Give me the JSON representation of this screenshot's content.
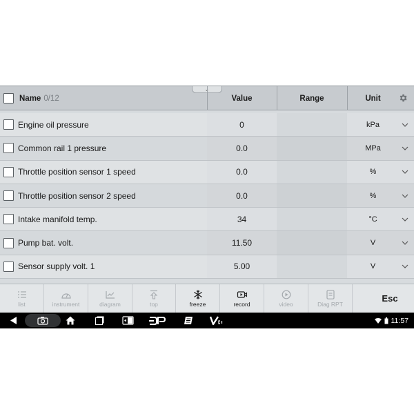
{
  "header": {
    "name_label": "Name",
    "count": "0/12",
    "value_label": "Value",
    "range_label": "Range",
    "unit_label": "Unit"
  },
  "rows": [
    {
      "name": "Engine oil pressure",
      "value": "0",
      "range": "",
      "unit": "kPa"
    },
    {
      "name": "Common rail 1 pressure",
      "value": "0.0",
      "range": "",
      "unit": "MPa"
    },
    {
      "name": "Throttle position sensor 1 speed",
      "value": "0.0",
      "range": "",
      "unit": "%"
    },
    {
      "name": "Throttle position sensor 2 speed",
      "value": "0.0",
      "range": "",
      "unit": "%"
    },
    {
      "name": "Intake manifold temp.",
      "value": "34",
      "range": "",
      "unit": "°C"
    },
    {
      "name": "Pump bat. volt.",
      "value": "11.50",
      "range": "",
      "unit": "V"
    },
    {
      "name": "Sensor supply volt. 1",
      "value": "5.00",
      "range": "",
      "unit": "V"
    }
  ],
  "toolbar": {
    "list": "list",
    "instrument": "instrument",
    "diagram": "diagram",
    "top": "top",
    "freeze": "freeze",
    "record": "record",
    "video": "video",
    "diag_rpt": "Diag RPT",
    "esc": "Esc"
  },
  "statusbar": {
    "time": "11:57"
  },
  "colors": {
    "header_bg": "#c7cbcf",
    "row_bg": "#dfe2e4",
    "toolbar_bg": "#e3e6e8",
    "nav_bg": "#000000"
  }
}
